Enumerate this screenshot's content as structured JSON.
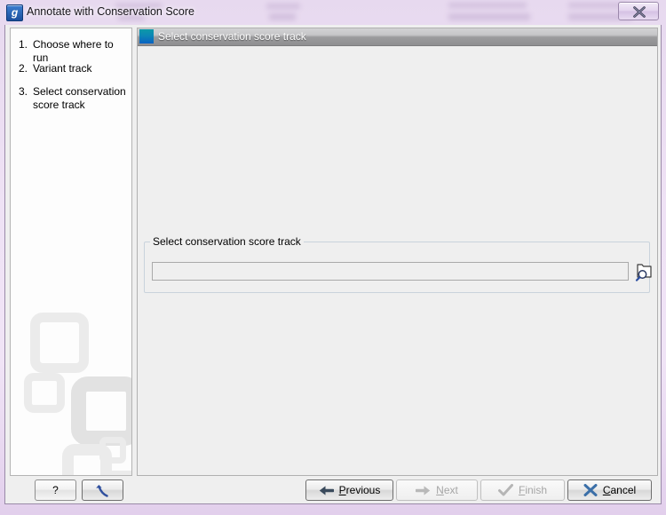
{
  "window": {
    "title": "Annotate with Conservation Score",
    "icon": "clc-workbench-icon",
    "close_icon": "close-icon",
    "close_label": "Close"
  },
  "sidebar": {
    "steps": [
      {
        "num": "1.",
        "label": "Choose where to run"
      },
      {
        "num": "2.",
        "label": "Variant track"
      },
      {
        "num": "3.",
        "label": "Select conservation score track"
      }
    ],
    "watermark": "clc-logo-watermark"
  },
  "panel": {
    "header_icon": "panel-step-icon",
    "header_title": "Select conservation score track",
    "group": {
      "legend": "Select conservation score track",
      "input_value": "",
      "input_placeholder": "",
      "browse_icon": "folder-search-icon",
      "browse_label": "Browse"
    }
  },
  "buttons": {
    "help": {
      "label": "?",
      "icon": "question-mark-icon",
      "enabled": true
    },
    "reset": {
      "label": "",
      "icon": "curved-arrow-reset-icon",
      "enabled": true
    },
    "previous": {
      "label": "Previous",
      "mnemonic": "P",
      "icon": "arrow-left-icon",
      "enabled": true
    },
    "next": {
      "label": "Next",
      "mnemonic": "N",
      "icon": "arrow-right-icon",
      "enabled": false
    },
    "finish": {
      "label": "Finish",
      "mnemonic": "F",
      "icon": "check-mark-icon",
      "enabled": false
    },
    "cancel": {
      "label": "Cancel",
      "mnemonic": "C",
      "icon": "x-mark-icon",
      "enabled": true
    }
  },
  "colors": {
    "glass_frame": "#e9dbf1",
    "panel_bg": "#efefef",
    "sidebar_bg": "#fdfdfd",
    "header_gradient_top": "#d2d2d4",
    "header_gradient_bottom": "#8f8f91",
    "step_icon_teal": "#0d9aa8",
    "step_icon_blue": "#0a62c2",
    "cancel_x": "#3b6fa8",
    "previous_arrow": "#3a4a5c"
  }
}
